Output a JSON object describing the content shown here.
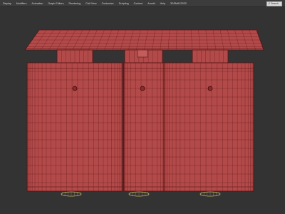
{
  "menubar": {
    "items": [
      "Display",
      "Modifiers",
      "Animation",
      "Graph Editors",
      "Rendering",
      "Civil View",
      "Customize",
      "Scripting",
      "Content",
      "Arnold",
      "Help",
      "3DSMAX2020"
    ],
    "search_placeholder": "Search"
  },
  "viewport": {
    "background": "#333333",
    "wire_fill": "#b24a4a",
    "wire_stroke": "#5a1212",
    "base_stroke": "#c8b46a"
  }
}
